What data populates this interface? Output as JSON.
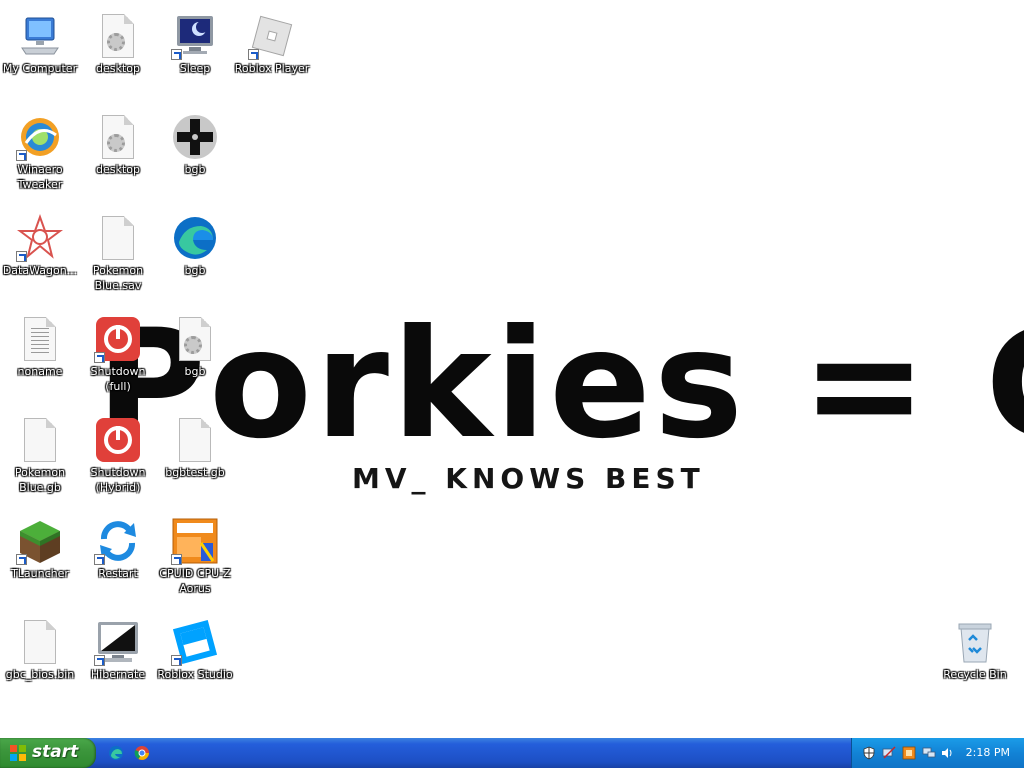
{
  "desktop_icons": [
    {
      "label": "My Computer",
      "icon": "my-computer-icon"
    },
    {
      "label": "desktop",
      "icon": "settings-file-icon"
    },
    {
      "label": "Sleep",
      "icon": "sleep-monitor-icon"
    },
    {
      "label": "Roblox Player",
      "icon": "roblox-player-icon"
    },
    {
      "label": "Winaero Tweaker",
      "icon": "winaero-tweaker-icon"
    },
    {
      "label": "desktop",
      "icon": "settings-file-icon"
    },
    {
      "label": "bgb",
      "icon": "bgb-dpad-icon"
    },
    {
      "label": "DataWagon...",
      "icon": "datawagon-icon"
    },
    {
      "label": "Pokemon Blue.sav",
      "icon": "blank-file-icon"
    },
    {
      "label": "bgb",
      "icon": "edge-icon"
    },
    {
      "label": "noname",
      "icon": "text-file-icon"
    },
    {
      "label": "Shutdown (full)",
      "icon": "power-icon"
    },
    {
      "label": "bgb",
      "icon": "settings-file-icon"
    },
    {
      "label": "Pokemon Blue.gb",
      "icon": "blank-file-icon"
    },
    {
      "label": "Shutdown (Hybrid)",
      "icon": "power-icon"
    },
    {
      "label": "bgbtest.gb",
      "icon": "blank-file-icon"
    },
    {
      "label": "TLauncher",
      "icon": "minecraft-grass-icon"
    },
    {
      "label": "Restart",
      "icon": "restart-icon"
    },
    {
      "label": "CPUID CPU-Z Aorus",
      "icon": "cpuz-aorus-icon"
    },
    {
      "label": "gbc_bios.bin",
      "icon": "blank-file-icon"
    },
    {
      "label": "Hibernate",
      "icon": "hibernate-monitor-icon"
    },
    {
      "label": "Roblox Studio",
      "icon": "roblox-studio-icon"
    },
    {
      "label": "Recycle Bin",
      "icon": "recycle-bin-icon"
    }
  ],
  "wallpaper": {
    "title": "Porkies = Gay",
    "subtitle": "MV_ KNOWS BEST"
  },
  "taskbar": {
    "start_label": "start",
    "quick_launch": [
      "edge-icon",
      "chrome-icon"
    ],
    "tray_icons": [
      "security-shield-icon",
      "network-offline-icon",
      "app-icon",
      "network-icon",
      "volume-icon"
    ],
    "clock": "2:18 PM"
  },
  "colors": {
    "taskbar_blue": "#245edb",
    "start_green": "#3c963c",
    "tray_blue": "#1283d6"
  }
}
